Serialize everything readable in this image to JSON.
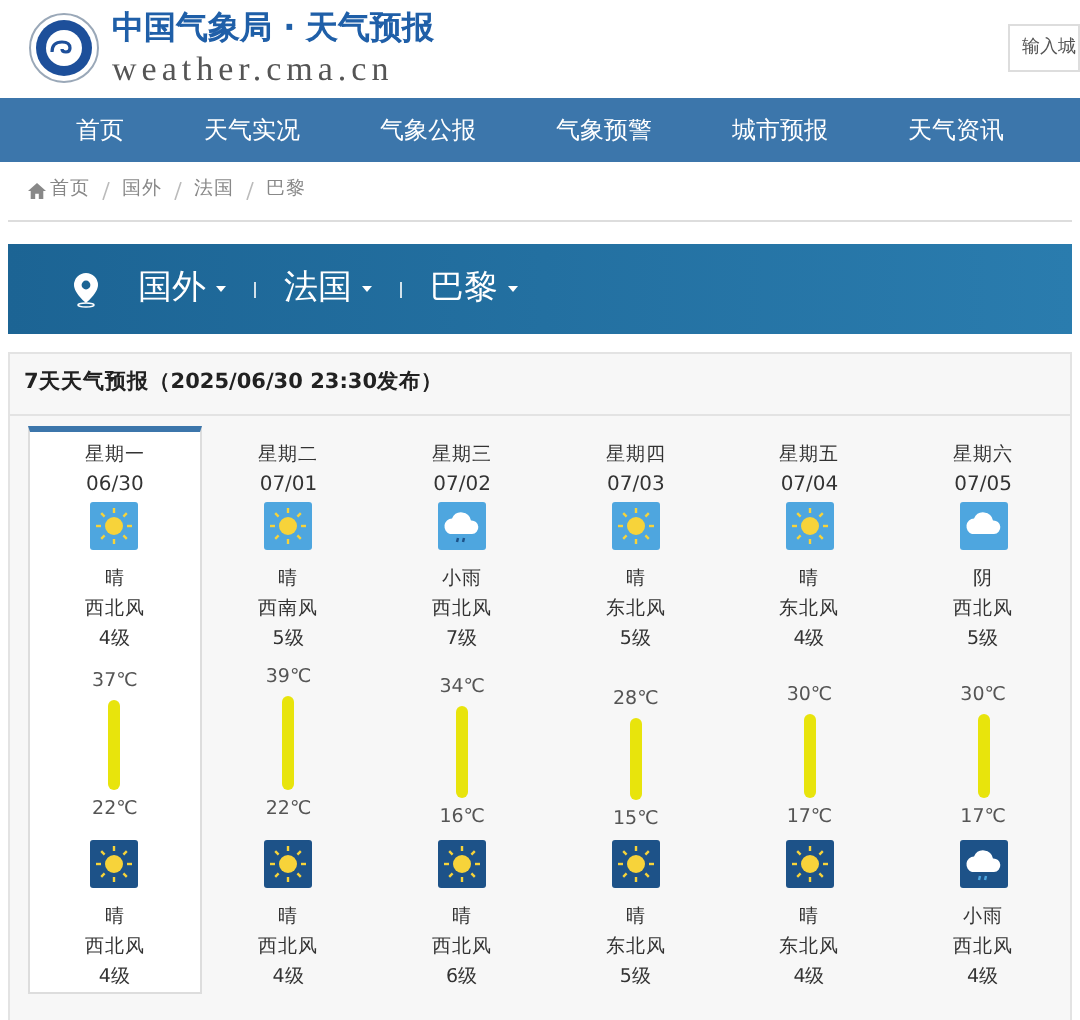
{
  "header": {
    "title": "中国气象局 · 天气预报",
    "domain": "weather.cma.cn",
    "search": {
      "placeholder": "输入城"
    }
  },
  "nav": [
    "首页",
    "天气实况",
    "气象公报",
    "气象预警",
    "城市预报",
    "天气资讯"
  ],
  "breadcrumb": [
    "首页",
    "国外",
    "法国",
    "巴黎"
  ],
  "location": [
    "国外",
    "法国",
    "巴黎"
  ],
  "forecast": {
    "title": "7天天气预报（2025/06/30 23:30发布）",
    "days": [
      {
        "weekday": "星期一",
        "date": "06/30",
        "selected": true,
        "day": {
          "kind": "sunny",
          "weather": "晴",
          "wind": "西北风",
          "level": "4级"
        },
        "high": "37℃",
        "low": "22℃",
        "night": {
          "kind": "sunny",
          "weather": "晴",
          "wind": "西北风",
          "level": "4级"
        }
      },
      {
        "weekday": "星期二",
        "date": "07/01",
        "selected": false,
        "day": {
          "kind": "sunny",
          "weather": "晴",
          "wind": "西南风",
          "level": "5级"
        },
        "high": "39℃",
        "low": "22℃",
        "night": {
          "kind": "sunny",
          "weather": "晴",
          "wind": "西北风",
          "level": "4级"
        }
      },
      {
        "weekday": "星期三",
        "date": "07/02",
        "selected": false,
        "day": {
          "kind": "rain",
          "weather": "小雨",
          "wind": "西北风",
          "level": "7级"
        },
        "high": "34℃",
        "low": "16℃",
        "night": {
          "kind": "sunny",
          "weather": "晴",
          "wind": "西北风",
          "level": "6级"
        }
      },
      {
        "weekday": "星期四",
        "date": "07/03",
        "selected": false,
        "day": {
          "kind": "sunny",
          "weather": "晴",
          "wind": "东北风",
          "level": "5级"
        },
        "high": "28℃",
        "low": "15℃",
        "night": {
          "kind": "sunny",
          "weather": "晴",
          "wind": "东北风",
          "level": "5级"
        }
      },
      {
        "weekday": "星期五",
        "date": "07/04",
        "selected": false,
        "day": {
          "kind": "sunny",
          "weather": "晴",
          "wind": "东北风",
          "level": "4级"
        },
        "high": "30℃",
        "low": "17℃",
        "night": {
          "kind": "sunny",
          "weather": "晴",
          "wind": "东北风",
          "level": "4级"
        }
      },
      {
        "weekday": "星期六",
        "date": "07/05",
        "selected": false,
        "day": {
          "kind": "cloudy",
          "weather": "阴",
          "wind": "西北风",
          "level": "5级"
        },
        "high": "30℃",
        "low": "17℃",
        "night": {
          "kind": "rain",
          "weather": "小雨",
          "wind": "西北风",
          "level": "4级"
        }
      }
    ]
  }
}
